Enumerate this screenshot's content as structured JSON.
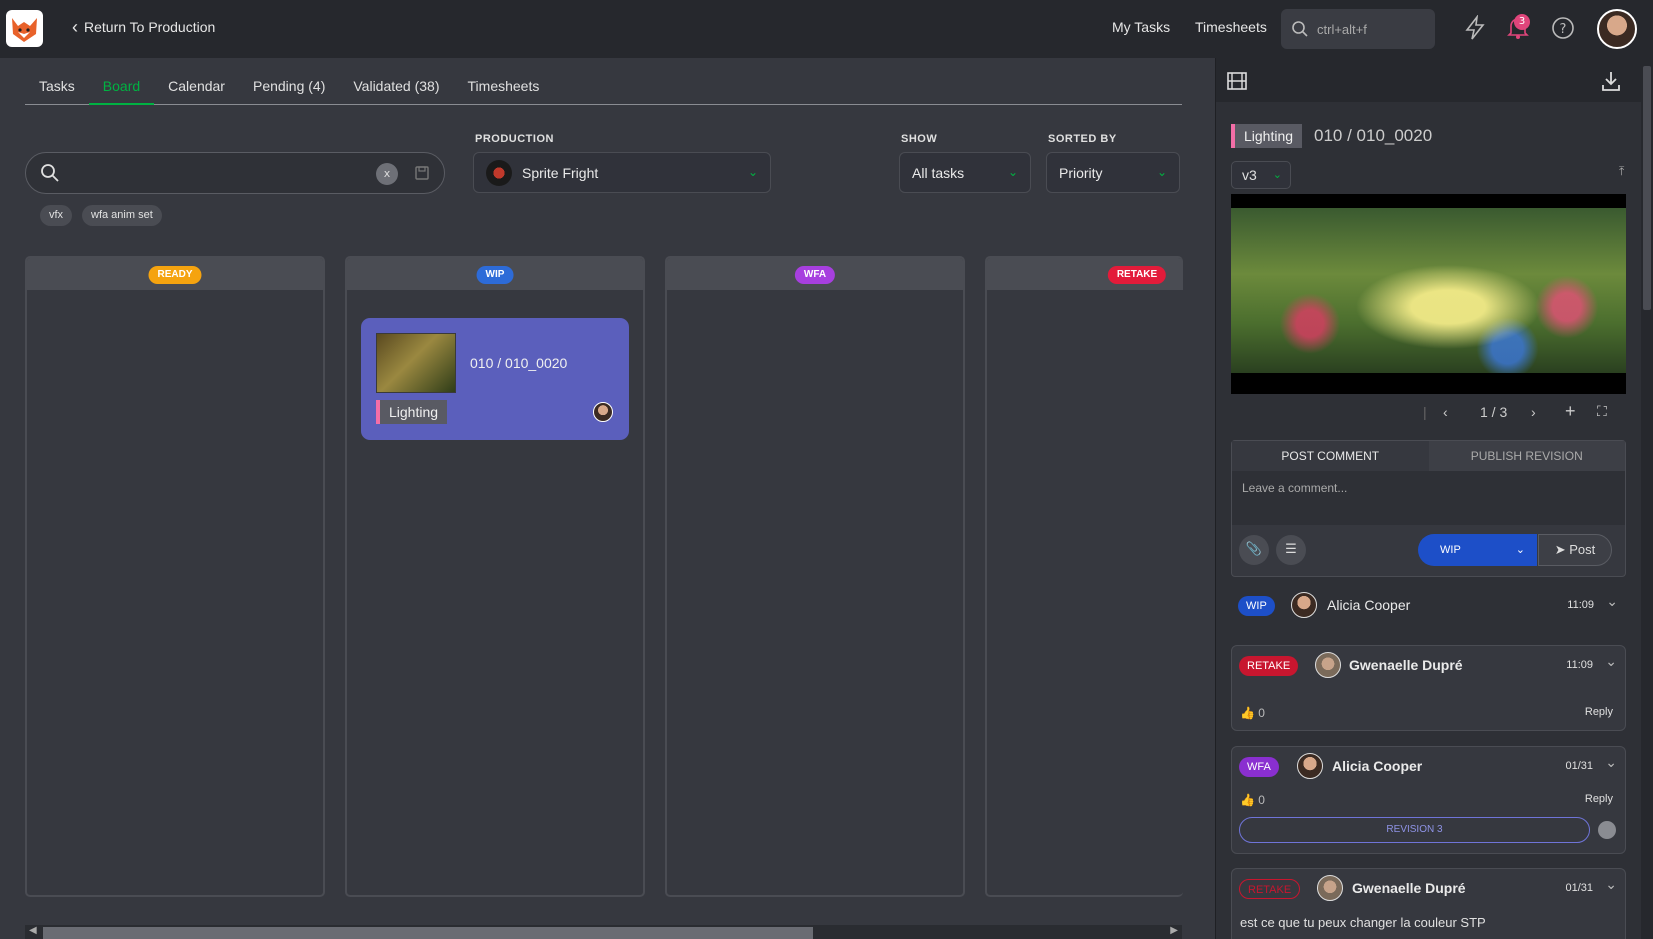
{
  "topbar": {
    "back_label": "Return To Production",
    "my_tasks": "My Tasks",
    "timesheets": "Timesheets",
    "search_placeholder": "ctrl+alt+f",
    "notifications_count": "3"
  },
  "tabs": [
    {
      "label": "Tasks"
    },
    {
      "label": "Board"
    },
    {
      "label": "Calendar"
    },
    {
      "label": "Pending (4)"
    },
    {
      "label": "Validated (38)"
    },
    {
      "label": "Timesheets"
    }
  ],
  "active_tab": "Board",
  "filters": {
    "search_value": "",
    "clear_label": "x",
    "chips": [
      "vfx",
      "wfa anim set"
    ],
    "production_label": "PRODUCTION",
    "production_value": "Sprite Fright",
    "show_label": "SHOW",
    "show_value": "All tasks",
    "sorted_label": "SORTED BY",
    "sorted_value": "Priority"
  },
  "columns": [
    {
      "status": "READY",
      "color": "#f5a30f"
    },
    {
      "status": "WIP",
      "color": "#2d6bd8"
    },
    {
      "status": "WFA",
      "color": "#a73fdf"
    },
    {
      "status": "RETAKE",
      "color": "#e31b3a"
    }
  ],
  "card": {
    "name": "010 / 010_0020",
    "task_type": "Lighting",
    "task_type_color": "#f36ea7"
  },
  "panel": {
    "task_type": "Lighting",
    "task_name": "010 / 010_0020",
    "version": "v3",
    "frame_counter": "1 / 3",
    "tab_post": "POST COMMENT",
    "tab_publish": "PUBLISH REVISION",
    "comment_placeholder": "Leave a comment...",
    "status_value": "WIP",
    "post_label": "Post"
  },
  "comments": [
    {
      "status": "WIP",
      "status_color": "#1d4fc8",
      "author": "Alicia Cooper",
      "time": "11:09"
    },
    {
      "status": "RETAKE",
      "status_color": "#c8162f",
      "author": "Gwenaelle Dupré",
      "time": "11:09",
      "likes": "0",
      "reply": "Reply"
    },
    {
      "status": "WFA",
      "status_color": "#8a2fd0",
      "author": "Alicia Cooper",
      "time": "01/31",
      "likes": "0",
      "reply": "Reply",
      "revision": "REVISION 3"
    },
    {
      "status": "RETAKE",
      "status_color": "#c8162f",
      "author": "Gwenaelle Dupré",
      "time": "01/31",
      "body": "est ce que tu peux changer la couleur STP"
    }
  ]
}
